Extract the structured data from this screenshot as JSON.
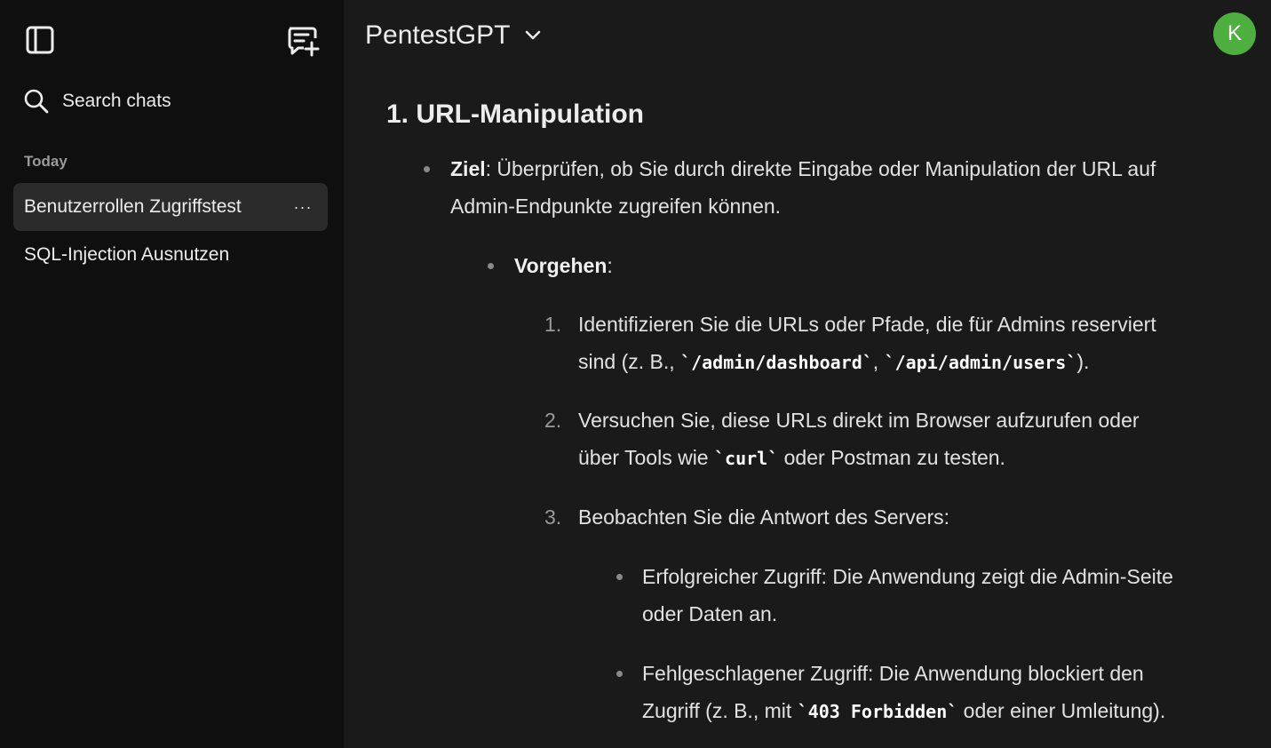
{
  "sidebar": {
    "toggle_icon": "sidebar-panel-icon",
    "new_chat_icon": "new-chat-icon",
    "search_label": "Search chats",
    "section_label": "Today",
    "chats": [
      {
        "label": "Benutzerrollen Zugriffstest",
        "more": "···"
      },
      {
        "label": "SQL-Injection Ausnutzen"
      }
    ]
  },
  "header": {
    "model": "PentestGPT",
    "avatar_letter": "K",
    "avatar_color": "#4caf3e"
  },
  "content": {
    "heading": "1. URL-Manipulation",
    "goal_label": "Ziel",
    "goal_line1": ": Überprüfen, ob Sie durch direkte Eingabe oder Manipulation der URL auf",
    "goal_line2": "Admin-Endpunkte zugreifen können.",
    "procedure_label": "Vorgehen",
    "procedure_colon": ":",
    "steps": [
      {
        "num": "1.",
        "line1": "Identifizieren Sie die URLs oder Pfade, die für Admins reserviert",
        "line2_pre": "sind (z. B., ",
        "code1": "`/admin/dashboard`",
        "sep": ", ",
        "code2": "`/api/admin/users`",
        "line2_post": ")."
      },
      {
        "num": "2.",
        "line1": "Versuchen Sie, diese URLs direkt im Browser aufzurufen oder",
        "line2_pre": "über Tools wie ",
        "code1": "`curl`",
        "line2_post": " oder Postman zu testen."
      },
      {
        "num": "3.",
        "line1": "Beobachten Sie die Antwort des Servers:"
      }
    ],
    "results": [
      {
        "line1": "Erfolgreicher Zugriff: Die Anwendung zeigt die Admin-Seite",
        "line2": "oder Daten an."
      },
      {
        "line1": "Fehlgeschlagener Zugriff: Die Anwendung blockiert den",
        "line2_pre": "Zugriff (z. B., mit ",
        "code": "`403 Forbidden`",
        "line2_post": " oder einer Umleitung)."
      }
    ]
  }
}
